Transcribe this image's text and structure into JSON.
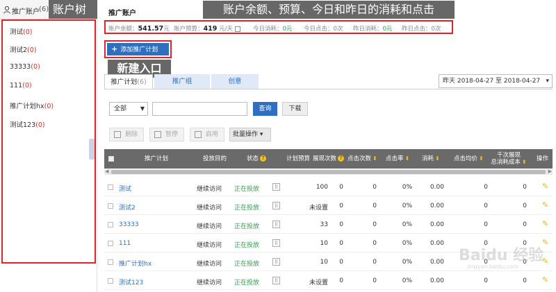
{
  "sidebar": {
    "title": "推广账户",
    "count": "(6)",
    "annotation": "账户树",
    "items": [
      {
        "label": "测试",
        "count": "(0)"
      },
      {
        "label": "测试2",
        "count": "(0)"
      },
      {
        "label": "33333",
        "count": "(0)"
      },
      {
        "label": "111",
        "count": "(0)"
      },
      {
        "label": "推广计划hx",
        "count": "(0)"
      },
      {
        "label": "测试123",
        "count": "(0)"
      }
    ]
  },
  "header": {
    "page_title": "推广账户",
    "annotation": "账户余额、预算、今日和昨日的消耗和点击"
  },
  "summary": {
    "balance_label": "账户余额：",
    "balance_value": "541.57",
    "balance_unit": "元",
    "budget_label": "账户预算：",
    "budget_value": "419",
    "budget_unit": "元/天",
    "today_cost_label": "今日消耗：",
    "today_cost_value": "0元",
    "today_click_label": "今日点击：",
    "today_click_value": "0次",
    "yest_cost_label": "昨日消耗：",
    "yest_cost_value": "0元",
    "yest_click_label": "昨日点击：",
    "yest_click_value": "0次"
  },
  "toolbar": {
    "add_plan_label": "添加推广计划",
    "add_annotation": "新建入口",
    "date_range": "昨天 2018-04-27 至 2018-04-27",
    "filter_value": "全部",
    "search_placeholder": "",
    "query_label": "查询",
    "download_label": "下载",
    "delete_label": "删除",
    "pause_label": "暂停",
    "enable_label": "启用",
    "bulk_label": "批量操作"
  },
  "tabs": [
    {
      "label": "推广计划",
      "count": "(6)"
    },
    {
      "label": "推广组",
      "count": ""
    },
    {
      "label": "创意",
      "count": ""
    }
  ],
  "table": {
    "headers": {
      "plan": "推广计划",
      "goal": "投放目的",
      "status": "状态",
      "budget": "计划预算",
      "impressions": "展现次数",
      "clicks": "点击次数",
      "ctr": "点击率",
      "cost": "消耗",
      "cpc": "点击均价",
      "cpm_line1": "千次展现",
      "cpm_line2": "总消耗成本",
      "ops": "操作"
    },
    "rows": [
      {
        "name": "测试",
        "goal": "继续访问",
        "status": "正在投放",
        "budget": "100",
        "impressions": "0",
        "clicks": "0",
        "ctr": "0%",
        "cost": "0.00",
        "cpc": "0",
        "cpm": "0"
      },
      {
        "name": "测试2",
        "goal": "继续访问",
        "status": "正在投放",
        "budget": "未设置",
        "impressions": "0",
        "clicks": "0",
        "ctr": "0%",
        "cost": "0.00",
        "cpc": "0",
        "cpm": "0"
      },
      {
        "name": "33333",
        "goal": "继续访问",
        "status": "正在投放",
        "budget": "33",
        "impressions": "0",
        "clicks": "0",
        "ctr": "0%",
        "cost": "0.00",
        "cpc": "0",
        "cpm": "0"
      },
      {
        "name": "111",
        "goal": "继续访问",
        "status": "正在投放",
        "budget": "10",
        "impressions": "0",
        "clicks": "0",
        "ctr": "0%",
        "cost": "0.00",
        "cpc": "0",
        "cpm": "0"
      },
      {
        "name": "推广计划hx",
        "goal": "继续访问",
        "status": "正在投放",
        "budget": "10",
        "impressions": "0",
        "clicks": "0",
        "ctr": "0%",
        "cost": "0.00",
        "cpc": "0",
        "cpm": "0"
      },
      {
        "name": "测试123",
        "goal": "继续访问",
        "status": "正在投放",
        "budget": "未设置",
        "impressions": "0",
        "clicks": "0",
        "ctr": "0%",
        "cost": "0.00",
        "cpc": "0",
        "cpm": "0"
      }
    ]
  },
  "watermark": {
    "main": "Baidu 经验",
    "sub": "jingyan.baidu.com"
  },
  "colors": {
    "accent": "#2f6fc2",
    "highlight": "#e0202a",
    "positive": "#28a745",
    "count_red": "#d9302a"
  }
}
